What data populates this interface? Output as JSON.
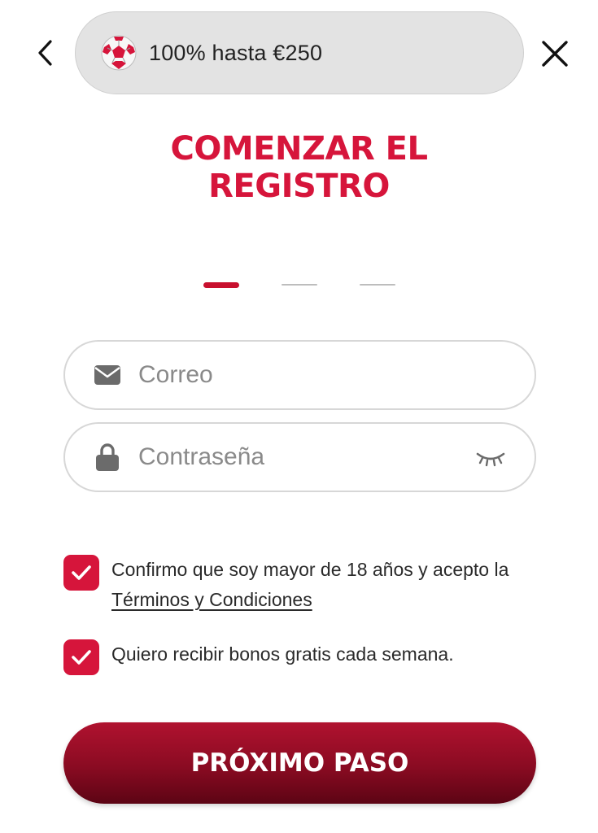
{
  "promo": {
    "text": "100% hasta €250"
  },
  "title": {
    "line1": "COMENZAR EL",
    "line2": "REGISTRO"
  },
  "steps": {
    "current": 1,
    "total": 3
  },
  "form": {
    "email": {
      "placeholder": "Correo",
      "value": ""
    },
    "password": {
      "placeholder": "Contraseña",
      "value": ""
    }
  },
  "consents": {
    "terms": {
      "checked": true,
      "text_before": "Confirmo que soy mayor de 18 años y acepto la ",
      "link_text": "Términos y Condiciones"
    },
    "bonus": {
      "checked": true,
      "text": "Quiero recibir bonos gratis cada semana."
    }
  },
  "next_button": {
    "label": "PRÓXIMO PASO"
  },
  "colors": {
    "accent": "#d6153b",
    "button_dark": "#8a0b22",
    "pill_bg": "#e3e3e3"
  },
  "icons": {
    "back": "chevron-left-icon",
    "close": "close-icon",
    "promo": "soccer-ball-icon",
    "email": "envelope-icon",
    "password": "lock-icon",
    "toggle": "eye-closed-icon",
    "check": "checkmark-icon"
  }
}
